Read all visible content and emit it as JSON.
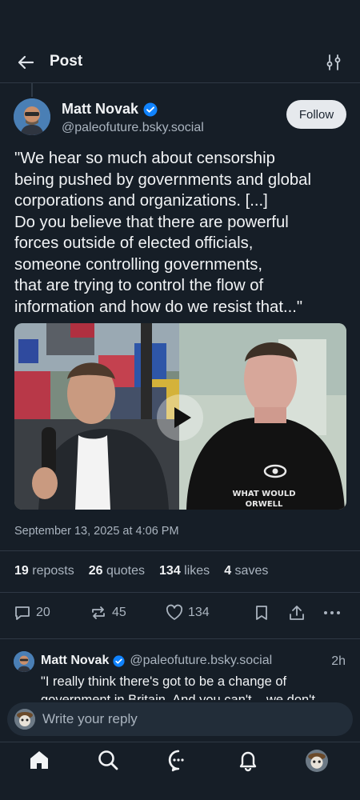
{
  "header": {
    "title": "Post"
  },
  "post": {
    "author_name": "Matt Novak",
    "author_handle": "@paleofuture.bsky.social",
    "follow_label": "Follow",
    "text": "\"We hear so much about censorship\nbeing pushed by governments and global\ncorporations and organizations. [...]\nDo you believe that there are powerful\nforces outside of elected officials,\nsomeone controlling governments,\nthat are trying to control the flow of\ninformation and how do we resist that...\"",
    "media_shirt_text": "WHAT WOULD\nORWELL THINK",
    "timestamp": "September 13, 2025 at 4:06 PM",
    "stats": {
      "reposts_count": "19",
      "reposts_label": "reposts",
      "quotes_count": "26",
      "quotes_label": "quotes",
      "likes_count": "134",
      "likes_label": "likes",
      "saves_count": "4",
      "saves_label": "saves"
    },
    "actions": {
      "replies": "20",
      "reposts": "45",
      "likes": "134"
    }
  },
  "reply": {
    "author_name": "Matt Novak",
    "author_handle": "@paleofuture.bsky.social",
    "time": "2h",
    "text": "\"I really think there's got to be a change of government in Britain. And you can't... we don't"
  },
  "compose": {
    "placeholder": "Write your reply"
  },
  "colors": {
    "background": "#161e27",
    "accent": "#1083fe",
    "muted": "#aab4bf"
  },
  "icons": [
    "back-arrow-icon",
    "filter-icon",
    "verified-icon",
    "play-icon",
    "reply-icon",
    "repost-icon",
    "like-icon",
    "bookmark-icon",
    "share-icon",
    "more-icon",
    "home-icon",
    "search-icon",
    "chat-icon",
    "bell-icon"
  ]
}
